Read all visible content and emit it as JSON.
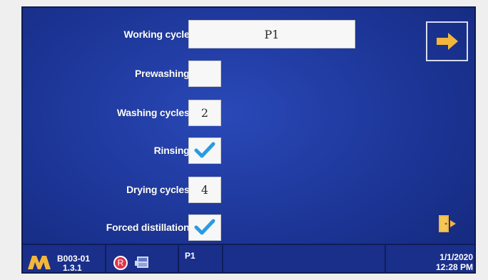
{
  "form": {
    "working_cycle": {
      "label": "Working cycle:",
      "value": "P1"
    },
    "prewashing": {
      "label": "Prewashing:",
      "value": ""
    },
    "washing_cycles": {
      "label": "Washing cycles:",
      "value": "2"
    },
    "rinsing": {
      "label": "Rinsing:",
      "checked": true
    },
    "drying_cycles": {
      "label": "Drying cycles:",
      "value": "4"
    },
    "forced_distillation": {
      "label": "Forced distillation:",
      "checked": true
    }
  },
  "nav": {
    "next_icon": "arrow-right-icon",
    "exit_icon": "exit-door-icon"
  },
  "status": {
    "machine_id": "B003-01",
    "version": "1.3.1",
    "r_badge": "R",
    "program": "P1",
    "date": "1/1/2020",
    "time": "12:28 PM"
  },
  "colors": {
    "background": "#1c3596",
    "field": "#f7f7f7",
    "check": "#2b9be0",
    "arrow": "#f3b63a",
    "badge": "#e0334a"
  }
}
